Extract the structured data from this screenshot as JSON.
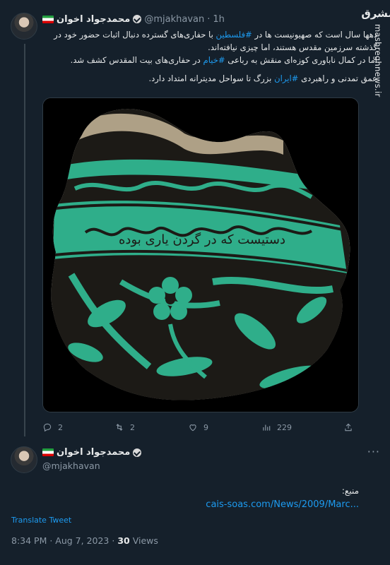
{
  "tweet": {
    "author_name": "محمدجواد اخوان",
    "handle": "@mjakhavan",
    "separator": "·",
    "time": "1h",
    "more": "···",
    "para1_before": "دهها سال است که صهیونیست ها در ",
    "para1_hashtag": "#فلسطین",
    "para1_after": " با حفاری‌های گسترده دنبال اثبات حضور خود در گذشته سرزمین مقدس هستند، اما چیزی نیافته‌اند.",
    "para2_before": "اما در کمال ناباوری کوزه‌ای منقش به رباعی ",
    "para2_hashtag": "#خیام",
    "para2_after": " در حفاری‌های بیت المقدس کشف شد.",
    "para3_before": "عمق تمدنی و راهبردی ",
    "para3_hashtag": "#ایران",
    "para3_after": " بزرگ تا سواحل مدیترانه امتداد دارد.",
    "watermark_logo": "مشرق",
    "watermark_site": "mashreghnews.ir",
    "pot_inscription": "دستیست که در گردن یاری بوده"
  },
  "actions": {
    "replies": "2",
    "retweets": "2",
    "likes": "9",
    "views": "229"
  },
  "quote": {
    "author_name": "محمدجواد اخوان",
    "handle": "@mjakhavan",
    "more": "···",
    "source_label": "منبع:",
    "source_link": "cais-soas.com/News/2009/Marc...",
    "translate": "Translate Tweet",
    "timestamp": "8:34 PM · Aug 7, 2023 · ",
    "views_count": "30",
    "views_label": " Views"
  },
  "colors": {
    "background": "#15202b",
    "link": "#1d9bf0",
    "muted": "#8b98a5",
    "pot_green": "#2fae8a",
    "pot_dark": "#1c1a16"
  }
}
